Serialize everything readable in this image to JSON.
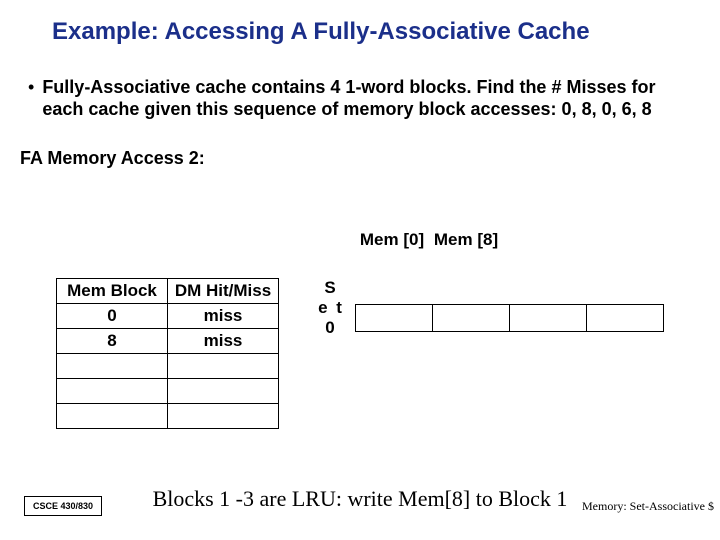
{
  "title": "Example: Accessing A Fully-Associative Cache",
  "bullet": "Fully-Associative cache contains 4 1-word blocks. Find the # Misses for each cache given this sequence of memory block accesses: 0, 8, 0, 6, 8",
  "subhead": "FA Memory Access 2:",
  "table1": {
    "h_mem": "Mem Block",
    "h_dm": "DM Hit/Miss",
    "rows": [
      {
        "mem": "0",
        "dm": "miss"
      },
      {
        "mem": "8",
        "dm": "miss"
      },
      {
        "mem": "",
        "dm": ""
      },
      {
        "mem": "",
        "dm": ""
      },
      {
        "mem": "",
        "dm": ""
      }
    ]
  },
  "set_label": {
    "l1": "S",
    "l2": "e t",
    "l3": "0"
  },
  "mem_headers": [
    "Mem [0]",
    "Mem [8]"
  ],
  "caption": "Blocks 1 -3 are LRU: write Mem[8] to Block 1",
  "course": "CSCE 430/830",
  "footnote": "Memory: Set-Associative $"
}
